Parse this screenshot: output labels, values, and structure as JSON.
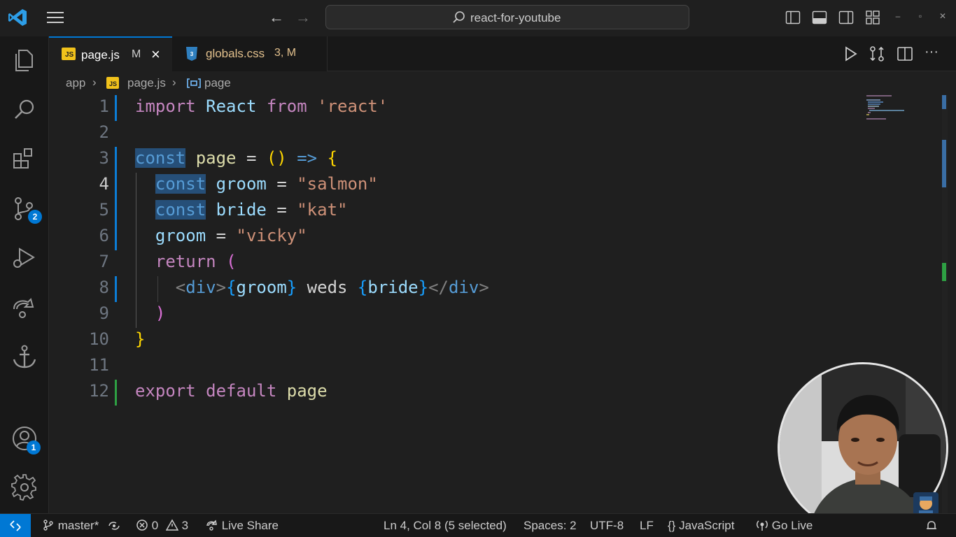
{
  "titlebar": {
    "search_text": "react-for-youtube"
  },
  "activity_bar": {
    "items": [
      {
        "icon": "files-icon"
      },
      {
        "icon": "search-icon"
      },
      {
        "icon": "extensions-icon"
      },
      {
        "icon": "source-control-icon",
        "badge": "2"
      },
      {
        "icon": "run-debug-icon"
      },
      {
        "icon": "live-share-icon"
      },
      {
        "icon": "anchor-icon"
      },
      {
        "icon": "account-icon",
        "badge": "1"
      },
      {
        "icon": "settings-gear-icon"
      }
    ]
  },
  "tabs": [
    {
      "label": "page.js",
      "status": "M",
      "active": true,
      "icon": "js-icon",
      "icon_text": "JS",
      "color": "#ffffff"
    },
    {
      "label": "globals.css",
      "status": "3, M",
      "active": false,
      "icon": "css-icon",
      "color": "#e2c08d"
    }
  ],
  "breadcrumb": {
    "folder": "app",
    "file": "page.js",
    "file_icon_text": "JS",
    "symbol": "page"
  },
  "editor": {
    "current_line": 4,
    "line_numbers": [
      "1",
      "2",
      "3",
      "4",
      "5",
      "6",
      "7",
      "8",
      "9",
      "10",
      "11",
      "12"
    ],
    "tokens": {
      "l1": [
        "import",
        "React",
        "from",
        "'react'"
      ],
      "l3": [
        "c",
        "onst",
        "page",
        "=",
        "()",
        "=>",
        "{"
      ],
      "l4": [
        "const",
        "groom",
        "=",
        "\"salmon\""
      ],
      "l5": [
        "const",
        "bride",
        "=",
        "\"kat\""
      ],
      "l6": [
        "groom",
        "=",
        "\"vicky\""
      ],
      "l7": [
        "return",
        "("
      ],
      "l8": [
        "<",
        "div",
        ">",
        "{",
        "groom",
        "}",
        " weds ",
        "{",
        "bride",
        "}",
        "</",
        "div",
        ">"
      ],
      "l9": [
        ")"
      ],
      "l10": [
        "}"
      ],
      "l12": [
        "export",
        "default",
        "page"
      ]
    }
  },
  "statusbar": {
    "branch": "master*",
    "errors": "0",
    "warnings": "3",
    "live_share": "Live Share",
    "position": "Ln 4, Col 8 (5 selected)",
    "spaces": "Spaces: 2",
    "encoding": "UTF-8",
    "eol": "LF",
    "language_braces": "{}",
    "language": "JavaScript",
    "go_live": "Go Live"
  },
  "colors": {
    "accent": "#0078d4",
    "keyword": "#c586c0",
    "storage": "#569cd6",
    "variable": "#9cdcfe",
    "string": "#ce9178",
    "bracket1": "#ffd700",
    "bracket2": "#da70d6",
    "bracket3": "#179fff"
  }
}
